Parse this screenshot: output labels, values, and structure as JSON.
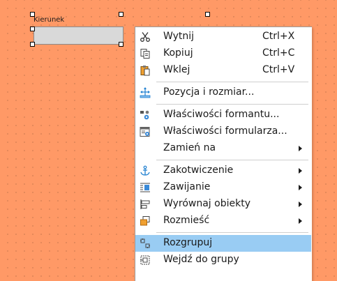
{
  "form": {
    "label_control_text": "Kierunek"
  },
  "context_menu": {
    "items": [
      {
        "label": "Wytnij",
        "shortcut": "Ctrl+X",
        "icon": "scissors-icon"
      },
      {
        "label": "Kopiuj",
        "shortcut": "Ctrl+C",
        "icon": "copy-icon"
      },
      {
        "label": "Wklej",
        "shortcut": "Ctrl+V",
        "icon": "paste-icon"
      },
      {
        "label": "Pozycja i rozmiar...",
        "shortcut": "",
        "icon": "position-size-icon"
      },
      {
        "label": "Właściwości formantu...",
        "shortcut": "",
        "icon": "control-properties-icon"
      },
      {
        "label": "Właściwości formularza...",
        "shortcut": "",
        "icon": "form-properties-icon"
      },
      {
        "label": "Zamień na",
        "shortcut": "",
        "icon": "",
        "submenu": true
      },
      {
        "label": "Zakotwiczenie",
        "shortcut": "",
        "icon": "anchor-icon",
        "submenu": true
      },
      {
        "label": "Zawijanie",
        "shortcut": "",
        "icon": "wrap-icon",
        "submenu": true
      },
      {
        "label": "Wyrównaj obiekty",
        "shortcut": "",
        "icon": "align-objects-icon",
        "submenu": true
      },
      {
        "label": "Rozmieść",
        "shortcut": "",
        "icon": "arrange-icon",
        "submenu": true
      },
      {
        "label": "Rozgrupuj",
        "shortcut": "",
        "icon": "ungroup-icon",
        "highlighted": true
      },
      {
        "label": "Wejdź do grupy",
        "shortcut": "",
        "icon": "enter-group-icon"
      }
    ]
  },
  "colors": {
    "canvas_background": "#ff9966",
    "highlight": "#99ccf3",
    "menu_background": "#ffffff",
    "icon_blue": "#1e7fd0",
    "icon_orange": "#f0a030"
  }
}
